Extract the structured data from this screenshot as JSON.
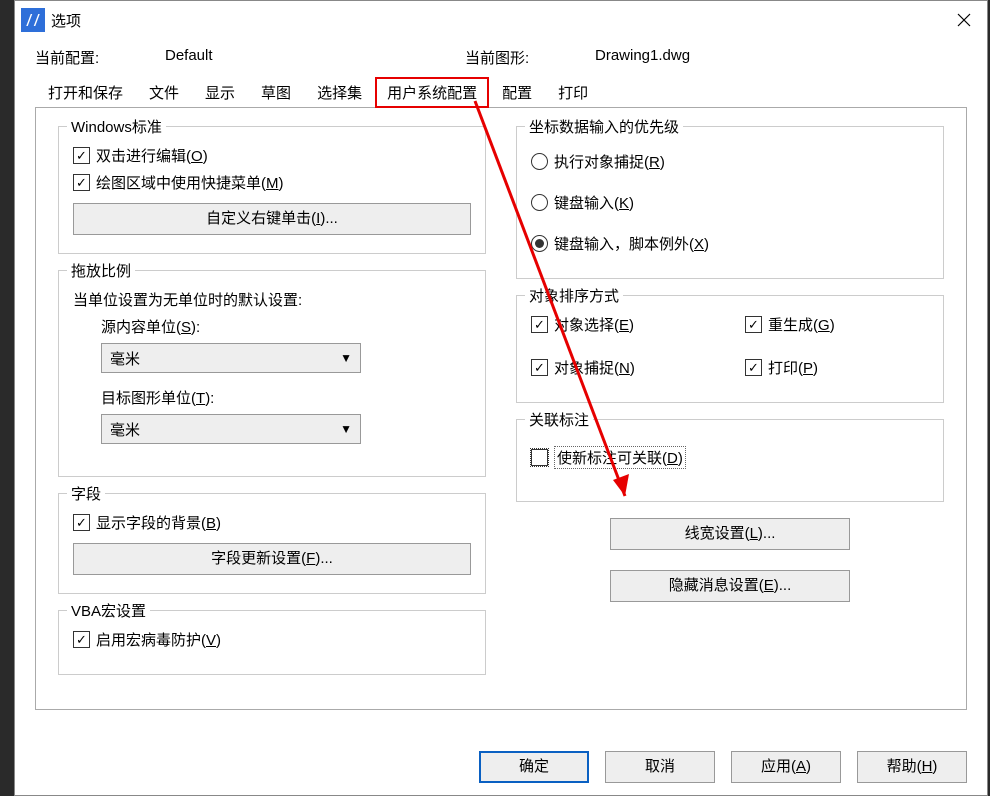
{
  "window": {
    "title": "选项"
  },
  "info": {
    "profile_label": "当前配置:",
    "profile_value": "Default",
    "drawing_label": "当前图形:",
    "drawing_value": "Drawing1.dwg"
  },
  "tabs": {
    "open_save": "打开和保存",
    "file": "文件",
    "display": "显示",
    "sketch": "草图",
    "selection": "选择集",
    "user_pref": "用户系统配置",
    "config": "配置",
    "print": "打印"
  },
  "left": {
    "winstd": {
      "title": "Windows标准",
      "dblclick": "双击进行编辑",
      "dblclick_key": "O",
      "shortcut": "绘图区域中使用快捷菜单",
      "shortcut_key": "M",
      "rclick_btn": "自定义右键单击",
      "rclick_key": "I"
    },
    "scale": {
      "title": "拖放比例",
      "desc": "当单位设置为无单位时的默认设置:",
      "src_label": "源内容单位",
      "src_key": "S",
      "src_value": "毫米",
      "tgt_label": "目标图形单位",
      "tgt_key": "T",
      "tgt_value": "毫米"
    },
    "field": {
      "title": "字段",
      "show_bg": "显示字段的背景",
      "show_bg_key": "B",
      "update_btn": "字段更新设置",
      "update_key": "F"
    },
    "vba": {
      "title": "VBA宏设置",
      "virus": "启用宏病毒防护",
      "virus_key": "V"
    }
  },
  "right": {
    "coord": {
      "title": "坐标数据输入的优先级",
      "r1": "执行对象捕捉",
      "r1_key": "R",
      "r2": "键盘输入",
      "r2_key": "K",
      "r3": "键盘输入，脚本例外",
      "r3_key": "X"
    },
    "sort": {
      "title": "对象排序方式",
      "c1": "对象选择",
      "c1_key": "E",
      "c2": "重生成",
      "c2_key": "G",
      "c3": "对象捕捉",
      "c3_key": "N",
      "c4": "打印",
      "c4_key": "P"
    },
    "assoc": {
      "title": "关联标注",
      "make": "使新标注可关联",
      "make_key": "D"
    },
    "lw_btn": "线宽设置",
    "lw_key": "L",
    "hide_btn": "隐藏消息设置",
    "hide_key": "E"
  },
  "footer": {
    "ok": "确定",
    "cancel": "取消",
    "apply": "应用",
    "apply_key": "A",
    "help": "帮助",
    "help_key": "H"
  },
  "ellipsis": "..."
}
